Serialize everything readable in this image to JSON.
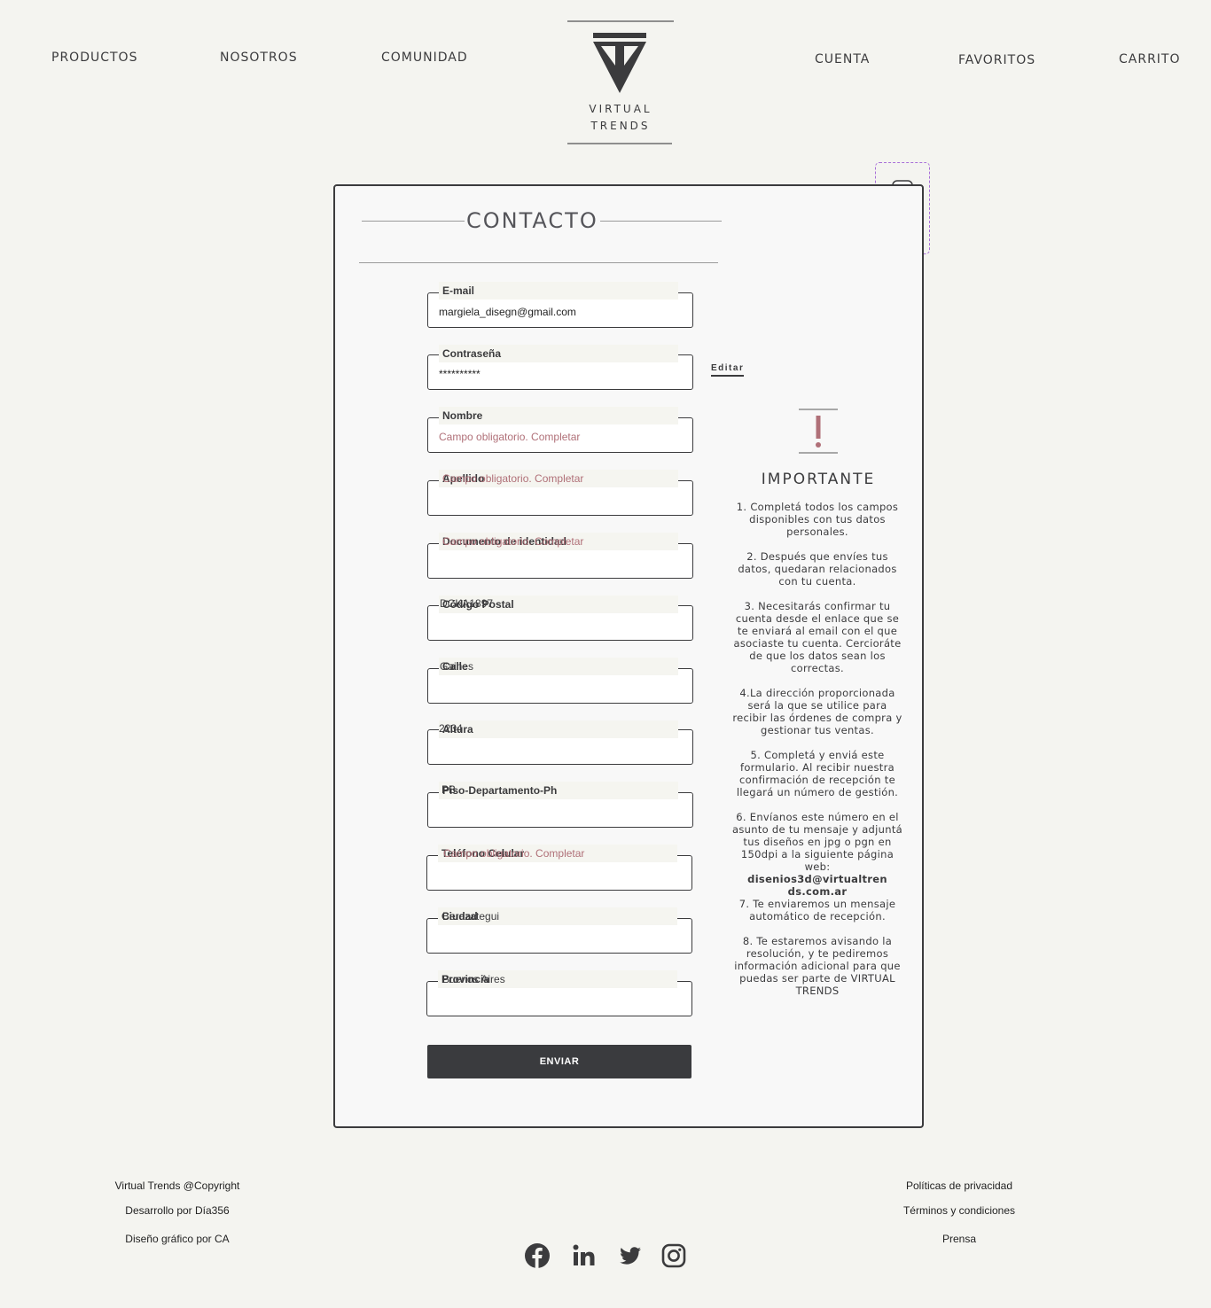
{
  "nav": {
    "left": [
      "PRODUCTOS",
      "NOSOTROS",
      "COMUNIDAD"
    ],
    "right": [
      "CUENTA",
      "FAVORITOS",
      "CARRITO"
    ]
  },
  "logo": {
    "line1": "VIRTUAL",
    "line2": "TRENDS"
  },
  "form": {
    "title": "CONTACTO",
    "edit_label": "Editar",
    "submit_label": "ENVIAR",
    "fields": [
      {
        "label": "E-mail",
        "value": "margiela_disegn@gmail.com"
      },
      {
        "label": "Contraseña",
        "value": "**********"
      },
      {
        "label": "Nombre",
        "value": "Campo obligatorio. Completar"
      },
      {
        "label": "Apellido",
        "ghost": "Campo obligatorio. Completar"
      },
      {
        "label": "Documento de identidad",
        "ghost": "Campo obligatorio. Completar"
      },
      {
        "label": "Código Postal",
        "ghost": "DCKA1897"
      },
      {
        "label": "Calle",
        "ghost": "Gaines"
      },
      {
        "label": "Altura",
        "ghost": "2234"
      },
      {
        "label": "Piso-Departamento-Ph",
        "ghost": "PB"
      },
      {
        "label": "Teléfono Celular",
        "ghost": "Campo obligatorio. Completar"
      },
      {
        "label": "Ciudad",
        "ghost": "Berazategui"
      },
      {
        "label": "Provincia",
        "ghost": "Buenos Aires"
      }
    ]
  },
  "important": {
    "title": "IMPORTANTE",
    "steps": [
      "1. Completá todos los campos disponibles con tus datos personales.",
      "2. Después que envíes tus datos, quedaran relacionados con tu cuenta.",
      "3. Necesitarás confirmar tu cuenta desde el enlace que se te enviará al email con el que asociaste tu cuenta. Cercioráte de que los datos sean los correctas.",
      "4.La dirección proporcionada será la que se utilice para recibir las órdenes de compra y gestionar tus ventas.",
      "5. Completá y enviá este formulario. Al recibir nuestra confirmación de recepción te llegará un número de gestión.",
      "6. Envíanos este número en el asunto de tu mensaje y adjuntá tus diseños en jpg o pgn en 150dpi a la siguiente página web:",
      "disenios3d@virtualtrends.com.ar",
      "7. Te enviaremos un mensaje automático de recepción.",
      "8. Te estaremos avisando la resolución, y te pediremos información adicional para que puedas  ser parte de VIRTUAL TRENDS"
    ]
  },
  "footer": {
    "left": [
      "Virtual Trends @Copyright",
      "Desarrollo por Día356",
      "Diseño gráfico por CA"
    ],
    "right": [
      "Políticas de privacidad",
      "Términos y condiciones",
      "Prensa"
    ],
    "social": [
      "facebook-icon",
      "linkedin-icon",
      "twitter-icon",
      "instagram-icon"
    ]
  },
  "colors": {
    "dark": "#3b3b3d",
    "error": "#b07078",
    "background": "#f4f4f0",
    "dashed_outline": "#a86fd8"
  }
}
